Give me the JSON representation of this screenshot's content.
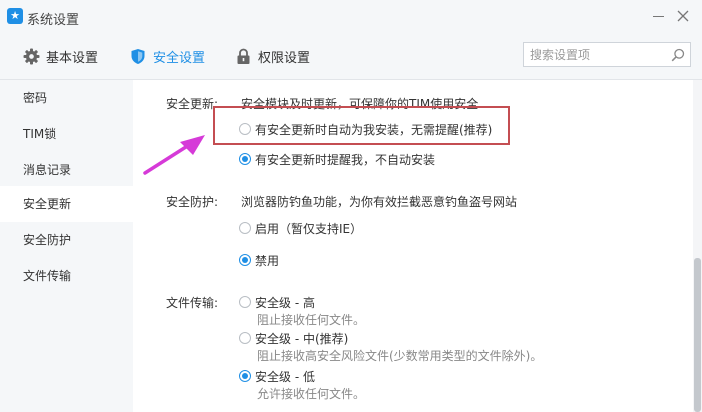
{
  "window": {
    "title": "系统设置",
    "app_icon": "star-icon"
  },
  "tabs": [
    {
      "label": "基本设置",
      "icon": "gear-icon"
    },
    {
      "label": "安全设置",
      "icon": "shield-icon",
      "active": true
    },
    {
      "label": "权限设置",
      "icon": "lock-icon"
    }
  ],
  "search": {
    "placeholder": "搜索设置项",
    "value": ""
  },
  "sidebar": {
    "items": [
      {
        "label": "密码"
      },
      {
        "label": "TIM锁"
      },
      {
        "label": "消息记录"
      },
      {
        "label": "安全更新",
        "active": true
      },
      {
        "label": "安全防护"
      },
      {
        "label": "文件传输"
      }
    ]
  },
  "security_update": {
    "label": "安全更新:",
    "description": "安全模块及时更新，可保障你的TIM使用安全",
    "options": [
      {
        "label": "有安全更新时自动为我安装，无需提醒(推荐)",
        "checked": false
      },
      {
        "label": "有安全更新时提醒我，不自动安装",
        "checked": true
      }
    ]
  },
  "security_protection": {
    "label": "安全防护:",
    "description": "浏览器防钓鱼功能，为你有效拦截恶意钓鱼盗号网站",
    "options": [
      {
        "label": "启用（暂仅支持IE）",
        "checked": false
      },
      {
        "label": "禁用",
        "checked": true
      }
    ]
  },
  "file_transfer": {
    "label": "文件传输:",
    "options": [
      {
        "label": "安全级 - 高",
        "sub": "阻止接收任何文件。",
        "checked": false
      },
      {
        "label": "安全级 - 中(推荐)",
        "sub": "阻止接收高安全风险文件(少数常用类型的文件除外)。",
        "checked": false
      },
      {
        "label": "安全级 - 低",
        "sub": "允许接收任何文件。",
        "checked": true
      }
    ]
  },
  "colors": {
    "accent": "#1f8fe5",
    "highlight_box": "#c44e52",
    "annotation_arrow": "#d63ad8"
  }
}
